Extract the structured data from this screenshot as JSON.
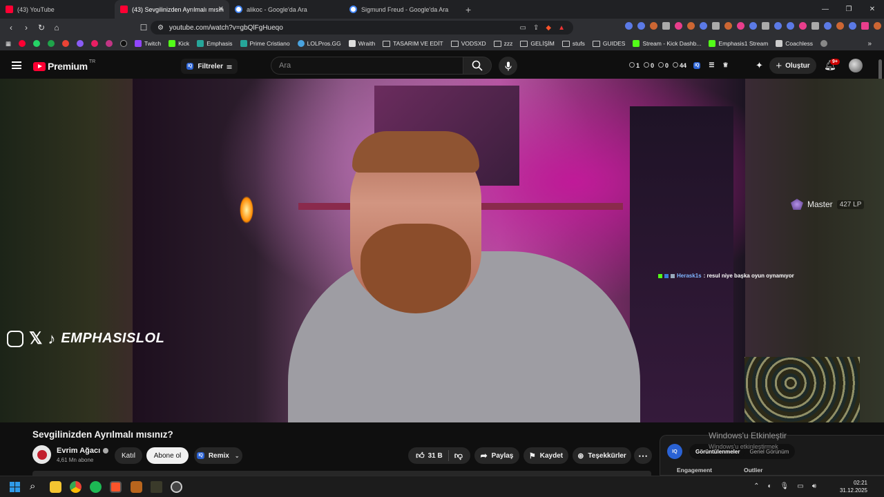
{
  "browser": {
    "tabs": [
      {
        "title": "(43) YouTube",
        "favicon": "youtube-favicon",
        "active": false
      },
      {
        "title": "(43) Sevgilinizden Ayrılmalı mısın",
        "favicon": "youtube-favicon",
        "active": true
      },
      {
        "title": "alikoc - Google'da Ara",
        "favicon": "google-favicon",
        "active": false
      },
      {
        "title": "Sigmund Freud - Google'da Ara",
        "favicon": "google-favicon",
        "active": false
      }
    ],
    "url": "youtube.com/watch?v=gbQlFgHueqo",
    "bookmarks": [
      "Twitch",
      "Kick",
      "Emphasis",
      "Prime Cristiano",
      "LOLPros.GG",
      "Wraith",
      "TASARIM VE EDİT",
      "VODSXD",
      "zzz",
      "GELİŞİM",
      "stufs",
      "GUIDES",
      "Stream - Kick Dashb...",
      "Emphasis1 Stream",
      "Coachless"
    ]
  },
  "youtube": {
    "logo_text": "Premium",
    "region": "TR",
    "filters_label": "Filtreler",
    "search_placeholder": "Ara",
    "stats": [
      "1",
      "0",
      "0",
      "44"
    ],
    "create_label": "Oluştur",
    "notifications": "9+"
  },
  "overlay": {
    "handle": "EMPHASISLOL",
    "rank_tier": "Master",
    "rank_lp": "427 LP",
    "chat_user": "Herask1s",
    "chat_message": ": resul niye başka oyun oynamıyor"
  },
  "video": {
    "title": "Sevgilinizden Ayrılmalı mısınız?",
    "channel": "Evrim Ağacı",
    "subscribers": "4,61 Mn abone",
    "join_label": "Katıl",
    "subscribe_label": "Abone ol",
    "remix_label": "Remix",
    "likes": "31 B",
    "share_label": "Paylaş",
    "save_label": "Kaydet",
    "thanks_label": "Teşekkürler"
  },
  "panel": {
    "tab_active": "Görüntülenmeler",
    "tab_inactive": "Genel Görünüm",
    "label_left": "Engagement",
    "label_right": "Outlier",
    "watermark_title": "Windows'u Etkinleştir",
    "watermark_sub": "Windows'u etkinleştirmek"
  },
  "taskbar": {
    "time": "02:21",
    "date": "31.12.2025"
  }
}
